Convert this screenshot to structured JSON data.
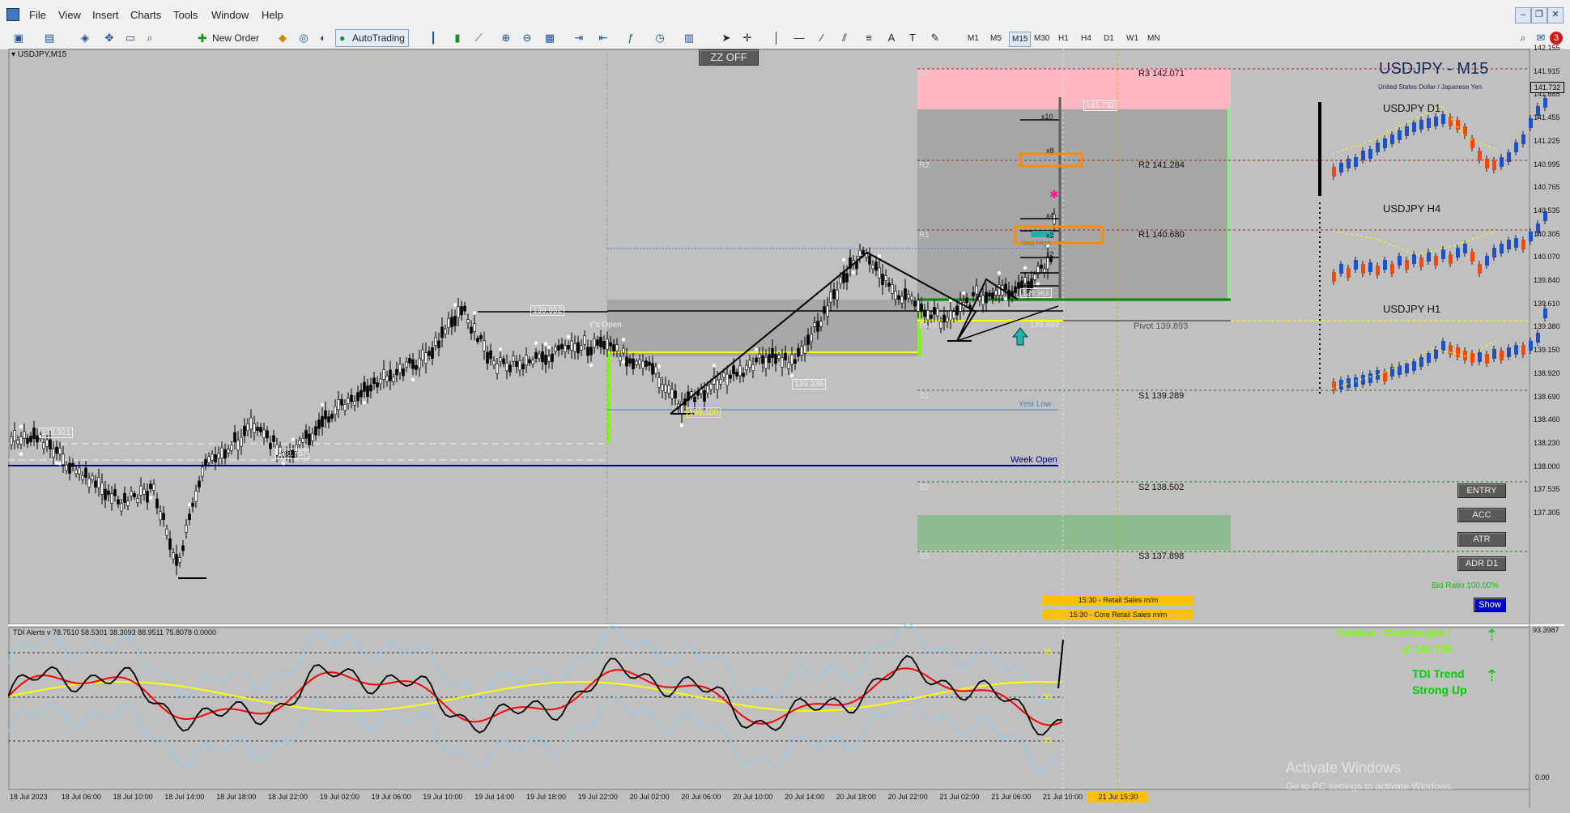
{
  "menu": {
    "items": [
      "File",
      "View",
      "Insert",
      "Charts",
      "Tools",
      "Window",
      "Help"
    ]
  },
  "toolbar": {
    "new_order": "New Order",
    "autotrading": "AutoTrading",
    "timeframes": [
      "M1",
      "M5",
      "M15",
      "M30",
      "H1",
      "H4",
      "D1",
      "W1",
      "MN"
    ],
    "active_timeframe": "M15",
    "notification_badge": "3"
  },
  "chart": {
    "symbol_label": "USDJPY,M15",
    "zz_button": "ZZ OFF",
    "title": "USDJPY - M15",
    "subtitle": "United States Dollar / Japanese Yen",
    "pivot_labels": {
      "r3": "R3 142.071",
      "r2": "R2 141.284",
      "r1": "R1 140.680",
      "pivot": "Pivot 139.893",
      "s1": "S1 139.289",
      "s2": "S2 138.502",
      "s3": "S3 137.898",
      "r3_short": "R3",
      "r2_short": "R2",
      "r1_short": "R1",
      "pivot_short": "Pivot",
      "s1_short": "S1",
      "s2_short": "S2",
      "s3_short": "S3"
    },
    "level_labels": {
      "ys_open": "Y's Open",
      "yest_low": "Yest Low",
      "week_open": "Week Open",
      "yest_high": "Yest High"
    },
    "price_tags": [
      "138.921",
      "138.757",
      "139.952",
      "139.336",
      "139.100",
      "141.732",
      "139.893",
      "139.963"
    ],
    "mini_charts": [
      "USDJPY D1",
      "USDJPY H4",
      "USDJPY H1"
    ],
    "side_buttons": [
      "ENTRY",
      "ACC",
      "ATR",
      "ADR D1"
    ],
    "bid_ratio": "Bid Ratio 100.00%",
    "show_button": "Show",
    "events": [
      "15:30 - Retail Sales m/m",
      "15:30 - Core Retail Sales m/m"
    ],
    "multipliers": [
      "x10",
      "x8",
      "x4",
      "x3",
      "x2"
    ],
    "price_axis": [
      "142.155",
      "141.915",
      "141.685",
      "141.455",
      "141.225",
      "140.995",
      "140.765",
      "140.535",
      "140.305",
      "140.070",
      "139.840",
      "139.610",
      "139.380",
      "139.150",
      "138.920",
      "138.690",
      "138.460",
      "138.230",
      "138.000",
      "137.535",
      "137.305"
    ],
    "current_price": "141.732"
  },
  "indicator": {
    "label": "TDI Alerts v 78.7510 58.5301 38.3093 88.9511 75.8078 0.0000",
    "caution": "Caution - Overbought !",
    "caution_price": "@ 141.730",
    "trend_title": "TDI Trend",
    "trend_value": "Strong Up",
    "levels": [
      "78",
      "50",
      "23"
    ],
    "axis_top": "93.3987",
    "axis_bottom": "0.00"
  },
  "time_axis": [
    "18 Jul 2023",
    "18 Jul 06:00",
    "18 Jul 10:00",
    "18 Jul 14:00",
    "18 Jul 18:00",
    "18 Jul 22:00",
    "19 Jul 02:00",
    "19 Jul 06:00",
    "19 Jul 10:00",
    "19 Jul 14:00",
    "19 Jul 18:00",
    "19 Jul 22:00",
    "20 Jul 02:00",
    "20 Jul 06:00",
    "20 Jul 10:00",
    "20 Jul 14:00",
    "20 Jul 18:00",
    "20 Jul 22:00",
    "21 Jul 02:00",
    "21 Jul 06:00",
    "21 Jul 10:00"
  ],
  "time_highlight": "21 Jul 15:30",
  "watermark": {
    "line1": "Activate Windows",
    "line2": "Go to PC settings to activate Windows."
  },
  "colors": {
    "bg": "#c0c0c0",
    "r3_zone": "#ffb6c1",
    "s3_zone": "#8fbc8f",
    "week_open": "#000080",
    "yellow": "#ffff00",
    "lime": "#00ff00",
    "tdi_red": "#ff0000",
    "tdi_blue": "#87cefa"
  }
}
